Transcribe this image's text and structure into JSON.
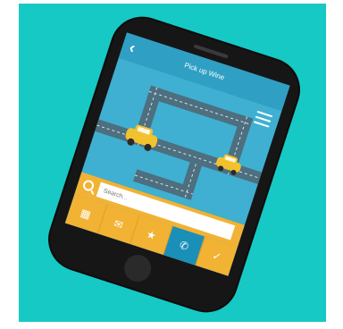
{
  "app": {
    "title": "Pick up Wine"
  },
  "search": {
    "placeholder": "Search..."
  },
  "icons": {
    "back": "back-icon",
    "menu": "hamburger-menu-icon",
    "search": "search-icon",
    "tabs": [
      "grid-icon",
      "chat-icon",
      "star-icon",
      "phone-icon",
      "check-icon"
    ]
  },
  "tab_glyphs": [
    "▦",
    "✉",
    "★",
    "✆",
    "✓"
  ],
  "colors": {
    "background": "#16c9c4",
    "screen": "#3fb0d1",
    "road": "#4d6f7f",
    "taxi": "#f2c22e",
    "bottom_bar": "#f2b233",
    "active_tab": "#1a8fb7"
  }
}
